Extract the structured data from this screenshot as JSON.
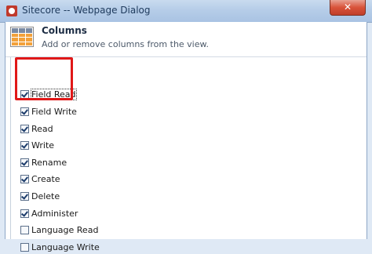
{
  "window": {
    "title": "Sitecore -- Webpage Dialog",
    "close_label": "✕"
  },
  "header": {
    "title": "Columns",
    "subtitle": "Add or remove columns from the view."
  },
  "columns": [
    {
      "label": "Field Read",
      "checked": true
    },
    {
      "label": "Field Write",
      "checked": true
    },
    {
      "label": "Read",
      "checked": true
    },
    {
      "label": "Write",
      "checked": true
    },
    {
      "label": "Rename",
      "checked": true
    },
    {
      "label": "Create",
      "checked": true
    },
    {
      "label": "Delete",
      "checked": true
    },
    {
      "label": "Administer",
      "checked": true
    },
    {
      "label": "Language Read",
      "checked": false
    },
    {
      "label": "Language Write",
      "checked": false
    }
  ],
  "colors": {
    "highlight": "#e01818",
    "title_bar": "#b6cde8"
  }
}
